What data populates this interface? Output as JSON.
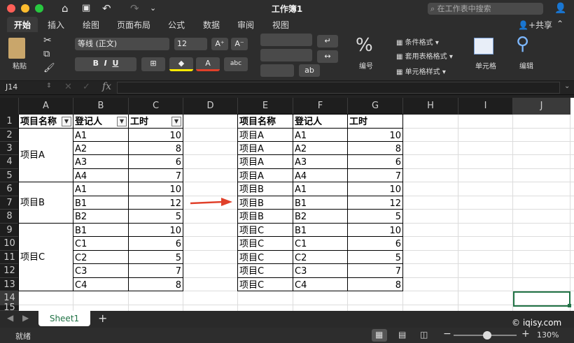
{
  "window": {
    "title": "工作簿1",
    "search_placeholder": "在工作表中搜索",
    "share_label": "共享"
  },
  "ribbon_tabs": [
    "开始",
    "插入",
    "绘图",
    "页面布局",
    "公式",
    "数据",
    "审阅",
    "视图"
  ],
  "ribbon": {
    "paste_label": "粘贴",
    "font_name": "等线 (正文)",
    "font_size": "12",
    "number_label": "编号",
    "cond_format": "条件格式",
    "table_format": "套用表格格式",
    "cell_style": "单元格样式",
    "cells_label": "单元格",
    "edit_label": "编辑"
  },
  "formula_bar": {
    "name_box": "J14",
    "fx": "fx",
    "formula": ""
  },
  "columns": [
    "A",
    "B",
    "C",
    "D",
    "E",
    "F",
    "G",
    "H",
    "I",
    "J"
  ],
  "rows": [
    "1",
    "2",
    "3",
    "4",
    "5",
    "6",
    "7",
    "8",
    "9",
    "10",
    "11",
    "12",
    "13",
    "14",
    "15"
  ],
  "left_table": {
    "headers": [
      "项目名称",
      "登记人",
      "工时"
    ],
    "groups": [
      {
        "name": "项目A",
        "rows": [
          [
            "A1",
            "10"
          ],
          [
            "A2",
            "8"
          ],
          [
            "A3",
            "6"
          ],
          [
            "A4",
            "7"
          ]
        ]
      },
      {
        "name": "项目B",
        "rows": [
          [
            "A1",
            "10"
          ],
          [
            "B1",
            "12"
          ],
          [
            "B2",
            "5"
          ]
        ]
      },
      {
        "name": "项目C",
        "rows": [
          [
            "B1",
            "10"
          ],
          [
            "C1",
            "6"
          ],
          [
            "C2",
            "5"
          ],
          [
            "C3",
            "7"
          ],
          [
            "C4",
            "8"
          ]
        ]
      }
    ]
  },
  "right_table": {
    "headers": [
      "项目名称",
      "登记人",
      "工时"
    ],
    "rows": [
      [
        "项目A",
        "A1",
        "10"
      ],
      [
        "项目A",
        "A2",
        "8"
      ],
      [
        "项目A",
        "A3",
        "6"
      ],
      [
        "项目A",
        "A4",
        "7"
      ],
      [
        "项目B",
        "A1",
        "10"
      ],
      [
        "项目B",
        "B1",
        "12"
      ],
      [
        "项目B",
        "B2",
        "5"
      ],
      [
        "项目C",
        "B1",
        "10"
      ],
      [
        "项目C",
        "C1",
        "6"
      ],
      [
        "项目C",
        "C2",
        "5"
      ],
      [
        "项目C",
        "C3",
        "7"
      ],
      [
        "项目C",
        "C4",
        "8"
      ]
    ]
  },
  "sheet_tabs": [
    "Sheet1"
  ],
  "status": {
    "ready": "就绪",
    "zoom": "130%",
    "watermark": "© iqisy.com"
  },
  "colors": {
    "accent": "#217346",
    "arrow": "#e0402a"
  }
}
